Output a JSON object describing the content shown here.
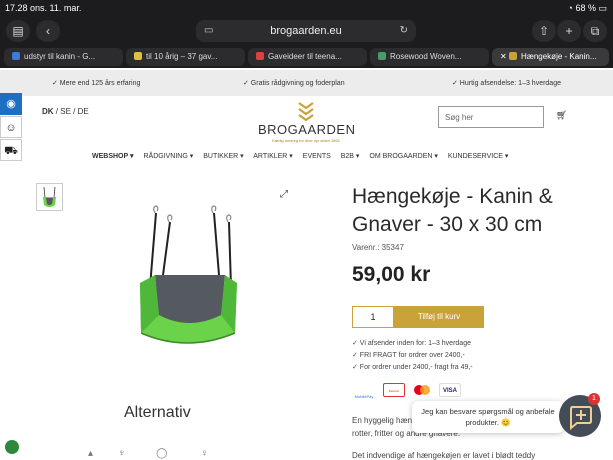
{
  "status": {
    "time": "17.28",
    "date": "ons. 11. mar.",
    "battery": "68 %"
  },
  "browser": {
    "address": "brogaarden.eu",
    "tabs": [
      {
        "label": "udstyr til kanin - G...",
        "fav_color": "#3b7ad8"
      },
      {
        "label": "til 10 årig – 37 gav...",
        "fav_color": "#e0c040"
      },
      {
        "label": "Gaveideer til teena...",
        "fav_color": "#e04040"
      },
      {
        "label": "Rosewood Woven...",
        "fav_color": "#4a9a6a"
      },
      {
        "label": "Hængekøje - Kanin...",
        "fav_color": "#c9a23a"
      }
    ]
  },
  "usp_bar": [
    "✓ Mere end 125 års erfaring",
    "✓ Gratis rådgivning og foderplan",
    "✓ Hurtig afsendelse: 1–3 hverdage"
  ],
  "lang": {
    "active": "DK",
    "sep1": "/",
    "se": "SE",
    "sep2": "/",
    "de": "DE"
  },
  "logo": {
    "name": "BROGAARDEN",
    "tagline": "Kærlig omsorg for dine dyr siden 1892"
  },
  "search": {
    "placeholder": "Søg her"
  },
  "nav": [
    "WEBSHOP ▾",
    "RÅDGIVNING ▾",
    "BUTIKKER ▾",
    "ARTIKLER ▾",
    "EVENTS",
    "B2B ▾",
    "OM BROGAARDEN ▾",
    "KUNDESERVICE ▾"
  ],
  "product": {
    "title": "Hængekøje - Kanin & Gnaver - 30 x 30 cm",
    "sku": "Varenr.: 35347",
    "price": "59,00 kr",
    "qty": "1",
    "add_label": "Tilføj til kurv",
    "usps": [
      "✓ Vi afsender inden for: 1–3 hverdage",
      "✓ FRI FRAGT for ordrer over 2400,-",
      "✓ For ordrer under 2400,- fragt fra 49,-"
    ],
    "payments": [
      "MobilePay",
      "Dankort",
      "Mastercard",
      "VISA"
    ],
    "desc1": "En hyggelig hængekøje til kaniner, marsvin,",
    "desc2": "rotter, fritter og andre gnavere.",
    "desc3": "Det indvendige af hængekøjen er lavet i blødt teddy"
  },
  "alternatives_title": "Alternativ",
  "chat": {
    "text": "Jeg kan besvare spørgsmål og anbefale produkter. 😊",
    "badge": "1"
  },
  "colors": {
    "gold": "#c9a23a",
    "green": "#6ad34a",
    "grey": "#555a60"
  }
}
